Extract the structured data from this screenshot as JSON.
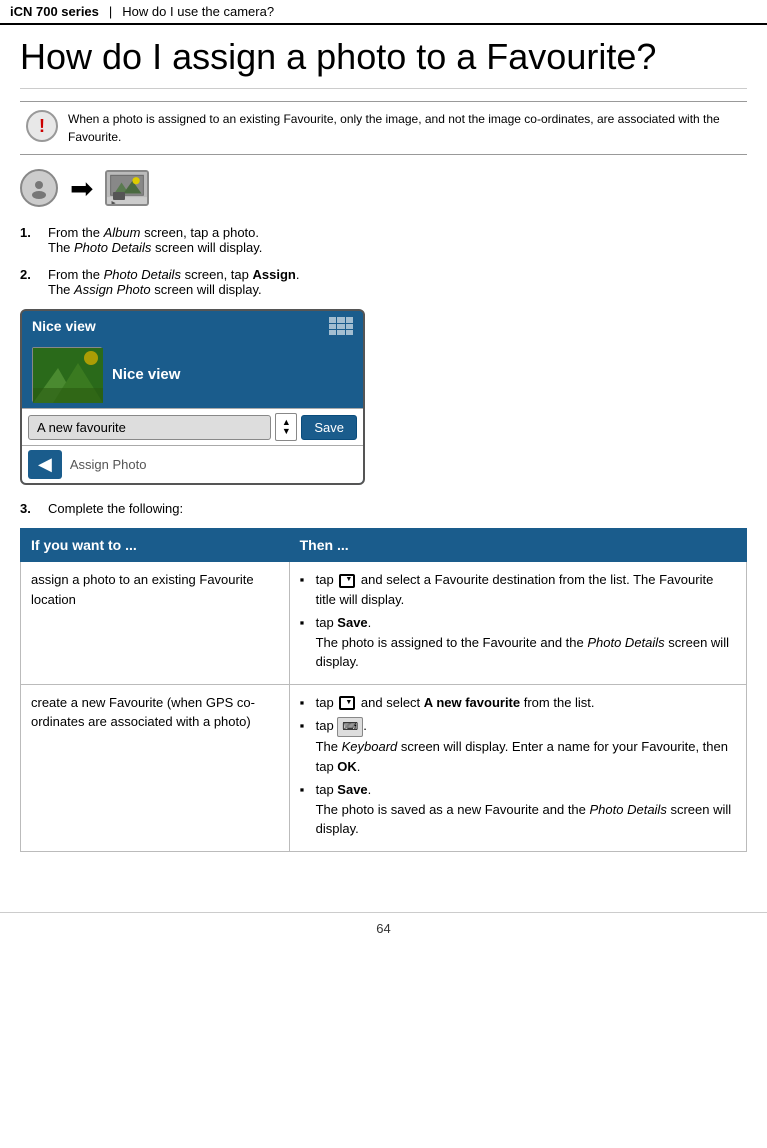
{
  "header": {
    "series": "iCN 700 series",
    "separator": "|",
    "section": "How do I use the camera?"
  },
  "page": {
    "title": "How do I assign a photo to a Favourite?",
    "notice": "When a photo is assigned to an existing Favourite, only the image, and not the image co-ordinates, are associated with the Favourite.",
    "steps": [
      {
        "number": "1.",
        "bold": "From the Album screen, tap a photo.",
        "sub": "The Photo Details screen will display."
      },
      {
        "number": "2.",
        "bold": "From the Photo Details screen, tap Assign.",
        "sub": "The Assign Photo screen will display."
      },
      {
        "number": "3.",
        "bold": "Complete the following:"
      }
    ],
    "gps_screen": {
      "title": "Nice view",
      "photo_label": "Nice view",
      "dropdown_value": "A new favourite",
      "save_button": "Save",
      "assign_label": "Assign Photo"
    },
    "table": {
      "col1_header": "If you want to ...",
      "col2_header": "Then ...",
      "rows": [
        {
          "col1": "assign a photo to an existing Favourite location",
          "col2_bullets": [
            "tap  and select a Favourite destination from the list. The Favourite title will display.",
            "tap Save. The photo is assigned to the Favourite and the Photo Details screen will display."
          ]
        },
        {
          "col1": "create a new Favourite (when GPS co-ordinates are associated with a photo)",
          "col2_bullets": [
            "tap  and select A new favourite from the list.",
            "tap . The Keyboard screen will display. Enter a name for your Favourite, then tap OK.",
            "tap Save. The photo is saved as a new Favourite and the Photo Details screen will display."
          ]
        }
      ]
    },
    "footer": {
      "page_number": "64"
    }
  }
}
